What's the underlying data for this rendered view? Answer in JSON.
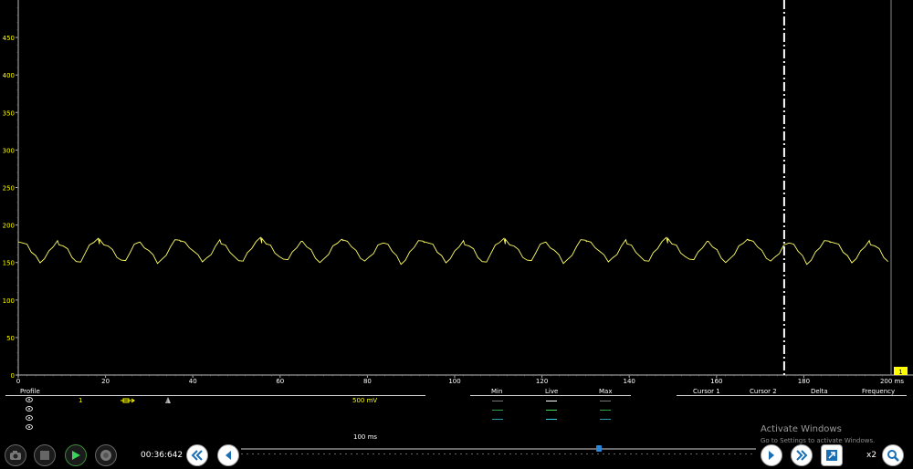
{
  "chart_data": {
    "type": "line",
    "title": "",
    "xlabel": "",
    "ylabel": "",
    "xlim": [
      0,
      200
    ],
    "ylim": [
      0,
      500
    ],
    "x_unit_label": "200 ms",
    "x_ticks": [
      "0",
      "20",
      "40",
      "60",
      "80",
      "100",
      "120",
      "140",
      "160",
      "180"
    ],
    "y_ticks": [
      "450",
      "400",
      "350",
      "300",
      "250",
      "200",
      "150",
      "100",
      "50",
      "0"
    ],
    "cursor_x": 175.5,
    "series": [
      {
        "color": "#ffff66",
        "period_ms": 9.3,
        "x": [
          0,
          1,
          2,
          3,
          4,
          5,
          6,
          7,
          8,
          9,
          9.3,
          10.3,
          11.3,
          12.3,
          13.3,
          14.3,
          15.3,
          16.3,
          17.3,
          18.3,
          18.6
        ],
        "values": [
          180,
          176,
          172,
          165,
          158,
          152,
          155,
          163,
          172,
          178,
          176,
          172,
          166,
          158,
          150,
          153,
          162,
          171,
          178,
          181,
          177
        ]
      }
    ],
    "grid": false
  },
  "channel_badge": "1",
  "profile": {
    "headers": {
      "profile": "Profile",
      "min": "Min",
      "live": "Live",
      "max": "Max",
      "cursor1": "Cursor 1",
      "cursor2": "Cursor 2",
      "delta": "Delta",
      "frequency": "Frequency"
    },
    "channel_number": "1",
    "scale": "500 mV",
    "timebase": "100 ms"
  },
  "colors": {
    "trace": "#ffff66",
    "axis_label": "#ffff00",
    "cursor": "#ffffff",
    "slider_thumb": "#2a86d8",
    "badge": "#ffff00"
  },
  "toolbar": {
    "time": "00:36:642",
    "zoom": "x2",
    "icons": [
      "camera-icon",
      "stop-icon",
      "play-icon",
      "record-icon",
      "rewind-icon",
      "step-back-icon",
      "step-forward-icon",
      "fast-forward-icon",
      "fullscreen-icon",
      "zoom-icon"
    ]
  },
  "watermark": {
    "title": "Activate Windows",
    "subtitle": "Go to Settings to activate Windows."
  }
}
